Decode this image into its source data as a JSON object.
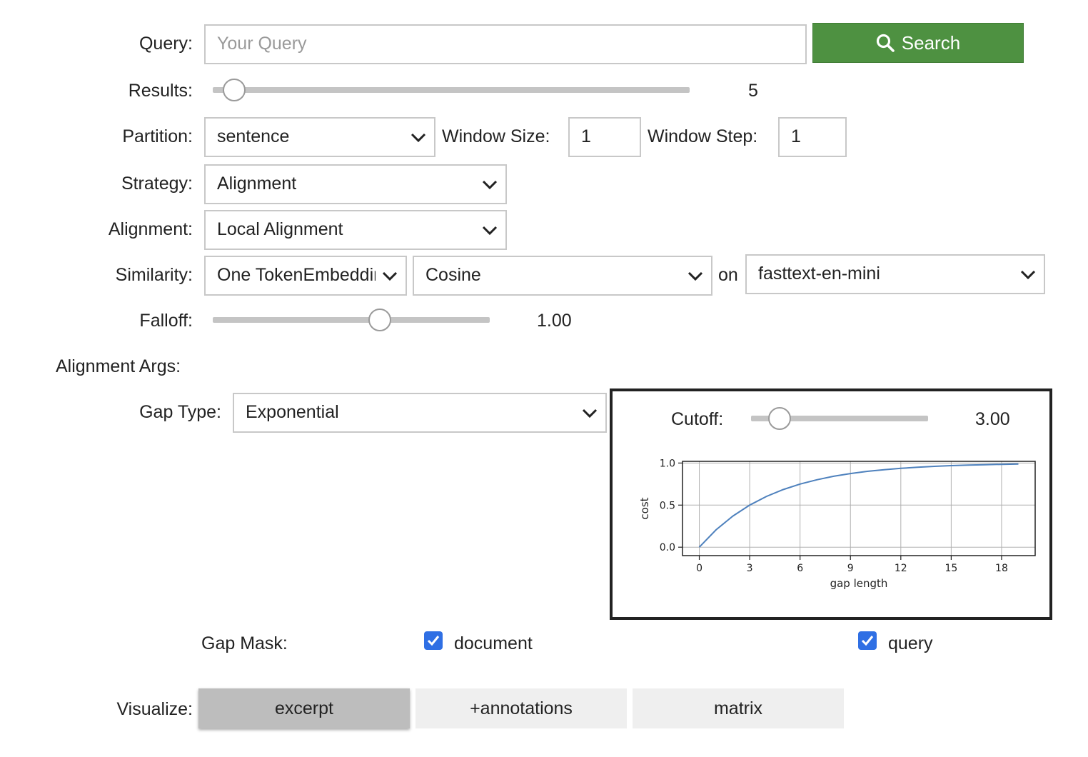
{
  "query": {
    "label": "Query:",
    "placeholder": "Your Query",
    "value": ""
  },
  "search_button": {
    "label": "Search",
    "icon": "search-icon"
  },
  "results": {
    "label": "Results:",
    "value": 5,
    "min": 1,
    "max": 100,
    "display": "5"
  },
  "partition": {
    "label": "Partition:",
    "selected": "sentence",
    "window_size_label": "Window Size:",
    "window_size": "1",
    "window_step_label": "Window Step:",
    "window_step": "1"
  },
  "strategy": {
    "label": "Strategy:",
    "selected": "Alignment"
  },
  "alignment": {
    "label": "Alignment:",
    "selected": "Local Alignment"
  },
  "similarity": {
    "label": "Similarity:",
    "embedding": "One TokenEmbedding",
    "metric": "Cosine",
    "on_label": "on",
    "model": "fasttext-en-mini"
  },
  "falloff": {
    "label": "Falloff:",
    "value": 1.0,
    "fraction": 0.6,
    "display": "1.00"
  },
  "alignment_args": {
    "label": "Alignment Args:",
    "gap_type_label": "Gap Type:",
    "gap_type": "Exponential"
  },
  "cutoff": {
    "label": "Cutoff:",
    "value": 3.0,
    "fraction": 0.15,
    "display": "3.00"
  },
  "chart_data": {
    "type": "line",
    "title": "",
    "xlabel": "gap length",
    "ylabel": "cost",
    "xlim": [
      -1,
      20
    ],
    "ylim": [
      -0.1,
      1.02
    ],
    "xticks": [
      0,
      3,
      6,
      9,
      12,
      15,
      18
    ],
    "yticks": [
      0.0,
      0.5,
      1.0
    ],
    "ytick_labels": [
      "0.0",
      "0.5",
      "1.0"
    ],
    "grid": true,
    "color": "#4e81bd",
    "series": [
      {
        "x": [
          0,
          1,
          2,
          3,
          4,
          5,
          6,
          7,
          8,
          9,
          10,
          11,
          12,
          13,
          14,
          15,
          16,
          17,
          18,
          19
        ],
        "y": [
          0.0,
          0.206,
          0.37,
          0.5,
          0.603,
          0.685,
          0.75,
          0.801,
          0.843,
          0.875,
          0.901,
          0.921,
          0.937,
          0.95,
          0.961,
          0.969,
          0.975,
          0.98,
          0.984,
          0.988
        ]
      }
    ]
  },
  "gap_mask": {
    "label": "Gap Mask:",
    "document_label": "document",
    "document_checked": true,
    "query_label": "query",
    "query_checked": true
  },
  "visualize": {
    "label": "Visualize:",
    "options": [
      "excerpt",
      "+annotations",
      "matrix"
    ],
    "selected": "excerpt"
  },
  "colors": {
    "accent_green": "#4e9141",
    "checkbox_blue": "#2f6fe4",
    "line_blue": "#4e81bd"
  }
}
